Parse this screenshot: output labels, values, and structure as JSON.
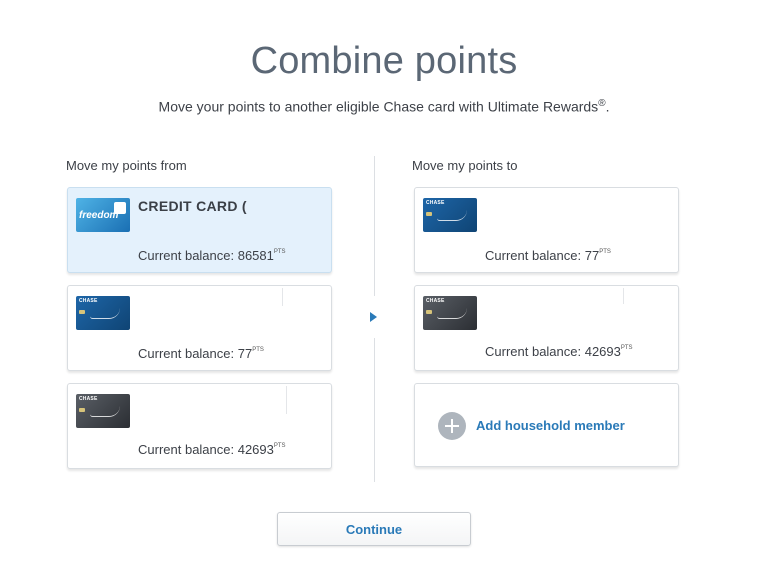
{
  "header": {
    "title": "Combine points",
    "subtitle": "Move your points to another eligible Chase card with Ultimate Rewards",
    "registered_mark": "®",
    "subtitle_end": "."
  },
  "from": {
    "heading": "Move my points from",
    "cards": [
      {
        "name": "CREDIT CARD (",
        "balance_label": "Current balance: 86581",
        "pts": "PTS",
        "image": "chase-freedom-card",
        "brand_text": "freedom",
        "selected": true
      },
      {
        "name": "",
        "balance_label": "Current balance: 77",
        "pts": "PTS",
        "image": "chase-sapphire-blue-card",
        "brand_text": "CHASE"
      },
      {
        "name": "",
        "balance_label": "Current balance: 42693",
        "pts": "PTS",
        "image": "chase-ink-dark-card",
        "brand_text": "CHASE"
      }
    ]
  },
  "to": {
    "heading": "Move my points to",
    "cards": [
      {
        "balance_label": "Current balance: 77",
        "pts": "PTS",
        "image": "chase-sapphire-blue-card",
        "brand_text": "CHASE"
      },
      {
        "balance_label": "Current balance: 42693",
        "pts": "PTS",
        "image": "chase-ink-dark-card",
        "brand_text": "CHASE"
      }
    ],
    "add_member_label": "Add household member"
  },
  "icons": {
    "arrow": "arrow-right-icon",
    "add": "plus-circle-icon"
  },
  "colors": {
    "accent": "#2a7ab8",
    "selected_bg": "#e4f1fc",
    "title": "#5b6775"
  },
  "continue_label": "Continue"
}
